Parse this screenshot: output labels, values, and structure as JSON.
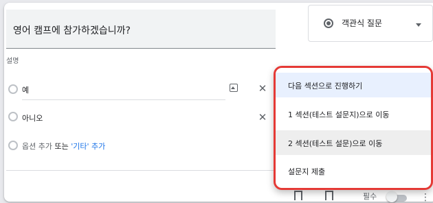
{
  "question": {
    "title": "영어 캠프에 참가하겠습니까?",
    "description_placeholder": "설명"
  },
  "type_select": {
    "icon": "radio-checked-icon",
    "label": "객관식 질문"
  },
  "options": [
    {
      "label": "예"
    },
    {
      "label": "아니오"
    }
  ],
  "add_option": {
    "prefix": "옵션 추가",
    "middle": "또는",
    "link": "'기타' 추가"
  },
  "footer": {
    "required_label": "필수"
  },
  "section_menu": {
    "items": [
      {
        "label": "다음 섹션으로 진행하기"
      },
      {
        "label": "1 섹션(테스트 설문지)으로 이동"
      },
      {
        "label": "2 섹션(테스트 설문)으로 이동"
      },
      {
        "label": "설문지 제출"
      }
    ],
    "highlight_color": "#e53935"
  }
}
